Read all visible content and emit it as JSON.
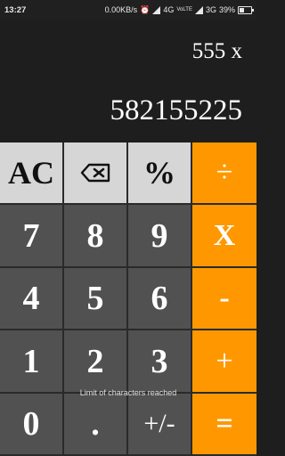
{
  "status_bar": {
    "time": "13:27",
    "net_speed": "0.00KB/s",
    "net1": "4G",
    "volte": "VoLTE",
    "net2": "3G",
    "battery": "39%",
    "battery_level": 0.39
  },
  "display": {
    "expression": "555 x",
    "result": "582155225"
  },
  "keys": {
    "ac": "AC",
    "percent": "%",
    "divide": "÷",
    "seven": "7",
    "eight": "8",
    "nine": "9",
    "multiply": "X",
    "four": "4",
    "five": "5",
    "six": "6",
    "minus": "-",
    "one": "1",
    "two": "2",
    "three": "3",
    "plus": "+",
    "zero": "0",
    "dot": ".",
    "sign": "+/-",
    "equals": "="
  },
  "toast": "Limit of characters reached",
  "colors": {
    "operator": "#ff9800",
    "number_key": "#515151",
    "top_key": "#d6d6d6",
    "display_bg": "#1e1e1e"
  }
}
